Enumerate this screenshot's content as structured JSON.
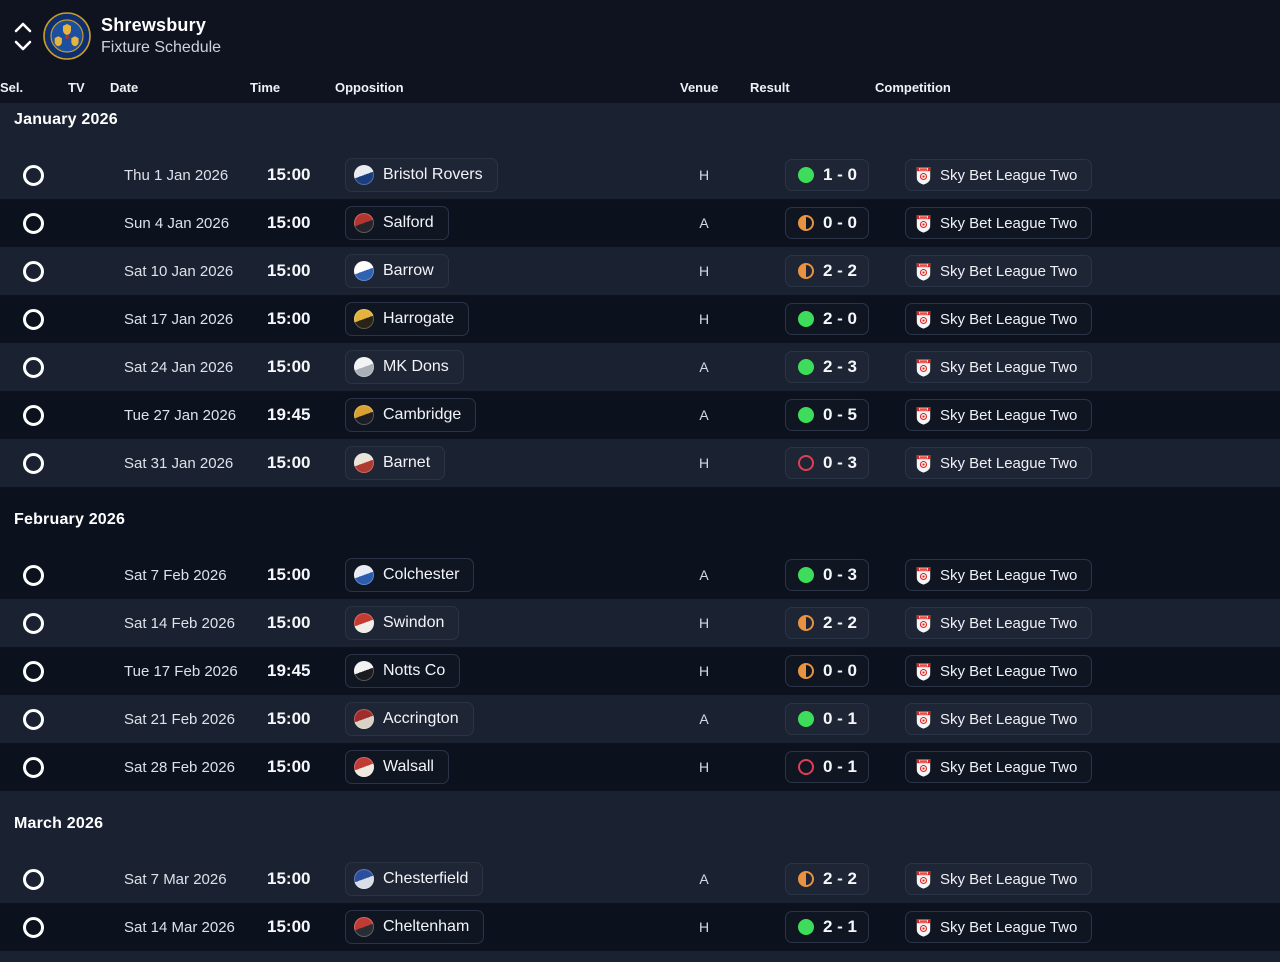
{
  "header": {
    "club_name": "Shrewsbury",
    "view_title": "Fixture Schedule"
  },
  "columns": {
    "sel": "Sel.",
    "tv": "TV",
    "date": "Date",
    "time": "Time",
    "opposition": "Opposition",
    "venue": "Venue",
    "result": "Result",
    "competition": "Competition"
  },
  "competition_label": "Sky Bet League Two",
  "colors": {
    "stripe_light": "#1a2130",
    "stripe_dark": "#0c111e",
    "win": "#3ddc5a",
    "draw": "#e9923f",
    "loss": "#e03e55",
    "box_border": "#2b3446"
  },
  "sections": [
    {
      "month": "January 2026",
      "fixtures": [
        {
          "date": "Thu 1 Jan 2026",
          "time": "15:00",
          "opponent": "Bristol Rovers",
          "badge": [
            "#e9edf0",
            "#1b3e7e"
          ],
          "venue": "H",
          "score": "1 - 0",
          "outcome": "win"
        },
        {
          "date": "Sun 4 Jan 2026",
          "time": "15:00",
          "opponent": "Salford",
          "badge": [
            "#b5342f",
            "#23252b"
          ],
          "venue": "A",
          "score": "0 - 0",
          "outcome": "draw"
        },
        {
          "date": "Sat 10 Jan 2026",
          "time": "15:00",
          "opponent": "Barrow",
          "badge": [
            "#ffffff",
            "#2f62b0"
          ],
          "venue": "H",
          "score": "2 - 2",
          "outcome": "draw"
        },
        {
          "date": "Sat 17 Jan 2026",
          "time": "15:00",
          "opponent": "Harrogate",
          "badge": [
            "#e3b33c",
            "#2a2416"
          ],
          "venue": "H",
          "score": "2 - 0",
          "outcome": "win"
        },
        {
          "date": "Sat 24 Jan 2026",
          "time": "15:00",
          "opponent": "MK Dons",
          "badge": [
            "#f2f3f5",
            "#a9b0ba"
          ],
          "venue": "A",
          "score": "2 - 3",
          "outcome": "win"
        },
        {
          "date": "Tue 27 Jan 2026",
          "time": "19:45",
          "opponent": "Cambridge",
          "badge": [
            "#d9a02e",
            "#1c1e24"
          ],
          "venue": "A",
          "score": "0 - 5",
          "outcome": "win"
        },
        {
          "date": "Sat 31 Jan 2026",
          "time": "15:00",
          "opponent": "Barnet",
          "badge": [
            "#e8e4da",
            "#b03a31"
          ],
          "venue": "H",
          "score": "0 - 3",
          "outcome": "loss"
        }
      ]
    },
    {
      "month": "February 2026",
      "fixtures": [
        {
          "date": "Sat 7 Feb 2026",
          "time": "15:00",
          "opponent": "Colchester",
          "badge": [
            "#e8edf5",
            "#2b5cb0"
          ],
          "venue": "A",
          "score": "0 - 3",
          "outcome": "win"
        },
        {
          "date": "Sat 14 Feb 2026",
          "time": "15:00",
          "opponent": "Swindon",
          "badge": [
            "#c53a31",
            "#f0eee9"
          ],
          "venue": "H",
          "score": "2 - 2",
          "outcome": "draw"
        },
        {
          "date": "Tue 17 Feb 2026",
          "time": "19:45",
          "opponent": "Notts Co",
          "badge": [
            "#f2f2f2",
            "#1b1c20"
          ],
          "venue": "H",
          "score": "0 - 0",
          "outcome": "draw"
        },
        {
          "date": "Sat 21 Feb 2026",
          "time": "15:00",
          "opponent": "Accrington",
          "badge": [
            "#a02c2c",
            "#d8d2c4"
          ],
          "venue": "A",
          "score": "0 - 1",
          "outcome": "win"
        },
        {
          "date": "Sat 28 Feb 2026",
          "time": "15:00",
          "opponent": "Walsall",
          "badge": [
            "#c23a34",
            "#efe9e0"
          ],
          "venue": "H",
          "score": "0 - 1",
          "outcome": "loss"
        }
      ]
    },
    {
      "month": "March 2026",
      "fixtures": [
        {
          "date": "Sat 7 Mar 2026",
          "time": "15:00",
          "opponent": "Chesterfield",
          "badge": [
            "#2b4f9e",
            "#d8dde8"
          ],
          "venue": "A",
          "score": "2 - 2",
          "outcome": "draw"
        },
        {
          "date": "Sat 14 Mar 2026",
          "time": "15:00",
          "opponent": "Cheltenham",
          "badge": [
            "#c23a34",
            "#2a2c33"
          ],
          "venue": "H",
          "score": "2 - 1",
          "outcome": "win"
        }
      ]
    }
  ]
}
